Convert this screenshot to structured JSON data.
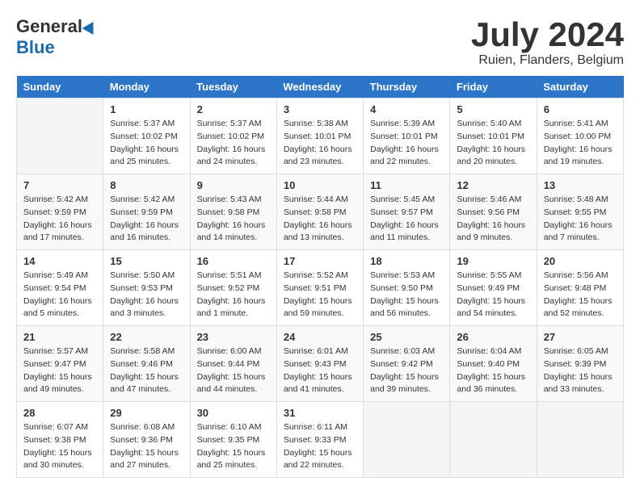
{
  "logo": {
    "general": "General",
    "blue": "Blue"
  },
  "title": "July 2024",
  "location": "Ruien, Flanders, Belgium",
  "headers": [
    "Sunday",
    "Monday",
    "Tuesday",
    "Wednesday",
    "Thursday",
    "Friday",
    "Saturday"
  ],
  "weeks": [
    [
      {
        "day": "",
        "info": ""
      },
      {
        "day": "1",
        "info": "Sunrise: 5:37 AM\nSunset: 10:02 PM\nDaylight: 16 hours\nand 25 minutes."
      },
      {
        "day": "2",
        "info": "Sunrise: 5:37 AM\nSunset: 10:02 PM\nDaylight: 16 hours\nand 24 minutes."
      },
      {
        "day": "3",
        "info": "Sunrise: 5:38 AM\nSunset: 10:01 PM\nDaylight: 16 hours\nand 23 minutes."
      },
      {
        "day": "4",
        "info": "Sunrise: 5:39 AM\nSunset: 10:01 PM\nDaylight: 16 hours\nand 22 minutes."
      },
      {
        "day": "5",
        "info": "Sunrise: 5:40 AM\nSunset: 10:01 PM\nDaylight: 16 hours\nand 20 minutes."
      },
      {
        "day": "6",
        "info": "Sunrise: 5:41 AM\nSunset: 10:00 PM\nDaylight: 16 hours\nand 19 minutes."
      }
    ],
    [
      {
        "day": "7",
        "info": "Sunrise: 5:42 AM\nSunset: 9:59 PM\nDaylight: 16 hours\nand 17 minutes."
      },
      {
        "day": "8",
        "info": "Sunrise: 5:42 AM\nSunset: 9:59 PM\nDaylight: 16 hours\nand 16 minutes."
      },
      {
        "day": "9",
        "info": "Sunrise: 5:43 AM\nSunset: 9:58 PM\nDaylight: 16 hours\nand 14 minutes."
      },
      {
        "day": "10",
        "info": "Sunrise: 5:44 AM\nSunset: 9:58 PM\nDaylight: 16 hours\nand 13 minutes."
      },
      {
        "day": "11",
        "info": "Sunrise: 5:45 AM\nSunset: 9:57 PM\nDaylight: 16 hours\nand 11 minutes."
      },
      {
        "day": "12",
        "info": "Sunrise: 5:46 AM\nSunset: 9:56 PM\nDaylight: 16 hours\nand 9 minutes."
      },
      {
        "day": "13",
        "info": "Sunrise: 5:48 AM\nSunset: 9:55 PM\nDaylight: 16 hours\nand 7 minutes."
      }
    ],
    [
      {
        "day": "14",
        "info": "Sunrise: 5:49 AM\nSunset: 9:54 PM\nDaylight: 16 hours\nand 5 minutes."
      },
      {
        "day": "15",
        "info": "Sunrise: 5:50 AM\nSunset: 9:53 PM\nDaylight: 16 hours\nand 3 minutes."
      },
      {
        "day": "16",
        "info": "Sunrise: 5:51 AM\nSunset: 9:52 PM\nDaylight: 16 hours\nand 1 minute."
      },
      {
        "day": "17",
        "info": "Sunrise: 5:52 AM\nSunset: 9:51 PM\nDaylight: 15 hours\nand 59 minutes."
      },
      {
        "day": "18",
        "info": "Sunrise: 5:53 AM\nSunset: 9:50 PM\nDaylight: 15 hours\nand 56 minutes."
      },
      {
        "day": "19",
        "info": "Sunrise: 5:55 AM\nSunset: 9:49 PM\nDaylight: 15 hours\nand 54 minutes."
      },
      {
        "day": "20",
        "info": "Sunrise: 5:56 AM\nSunset: 9:48 PM\nDaylight: 15 hours\nand 52 minutes."
      }
    ],
    [
      {
        "day": "21",
        "info": "Sunrise: 5:57 AM\nSunset: 9:47 PM\nDaylight: 15 hours\nand 49 minutes."
      },
      {
        "day": "22",
        "info": "Sunrise: 5:58 AM\nSunset: 9:46 PM\nDaylight: 15 hours\nand 47 minutes."
      },
      {
        "day": "23",
        "info": "Sunrise: 6:00 AM\nSunset: 9:44 PM\nDaylight: 15 hours\nand 44 minutes."
      },
      {
        "day": "24",
        "info": "Sunrise: 6:01 AM\nSunset: 9:43 PM\nDaylight: 15 hours\nand 41 minutes."
      },
      {
        "day": "25",
        "info": "Sunrise: 6:03 AM\nSunset: 9:42 PM\nDaylight: 15 hours\nand 39 minutes."
      },
      {
        "day": "26",
        "info": "Sunrise: 6:04 AM\nSunset: 9:40 PM\nDaylight: 15 hours\nand 36 minutes."
      },
      {
        "day": "27",
        "info": "Sunrise: 6:05 AM\nSunset: 9:39 PM\nDaylight: 15 hours\nand 33 minutes."
      }
    ],
    [
      {
        "day": "28",
        "info": "Sunrise: 6:07 AM\nSunset: 9:38 PM\nDaylight: 15 hours\nand 30 minutes."
      },
      {
        "day": "29",
        "info": "Sunrise: 6:08 AM\nSunset: 9:36 PM\nDaylight: 15 hours\nand 27 minutes."
      },
      {
        "day": "30",
        "info": "Sunrise: 6:10 AM\nSunset: 9:35 PM\nDaylight: 15 hours\nand 25 minutes."
      },
      {
        "day": "31",
        "info": "Sunrise: 6:11 AM\nSunset: 9:33 PM\nDaylight: 15 hours\nand 22 minutes."
      },
      {
        "day": "",
        "info": ""
      },
      {
        "day": "",
        "info": ""
      },
      {
        "day": "",
        "info": ""
      }
    ]
  ]
}
